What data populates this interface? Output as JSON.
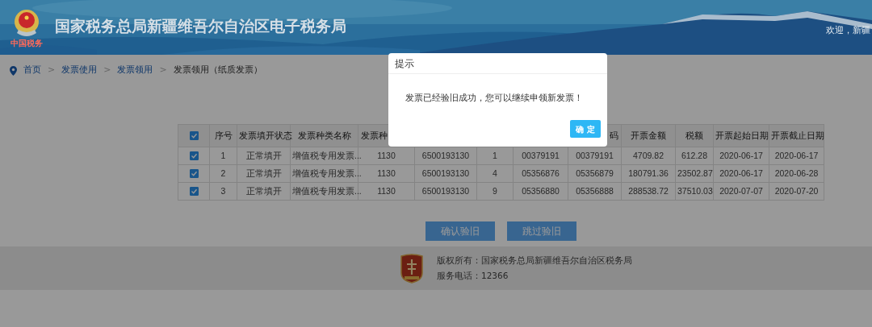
{
  "header": {
    "logo_caption": "中国税务",
    "title": "国家税务总局新疆维吾尔自治区电子税务局",
    "welcome": "欢迎，新疆"
  },
  "breadcrumb": {
    "items": [
      {
        "label": "首页",
        "kind": "link"
      },
      {
        "label": "发票使用",
        "kind": "link"
      },
      {
        "label": "发票领用",
        "kind": "link"
      },
      {
        "label": "发票领用（纸质发票）",
        "kind": "text"
      }
    ],
    "separators": [
      ">",
      ">",
      ">"
    ]
  },
  "table": {
    "select_all": {
      "checked": true
    },
    "columns": [
      "序号",
      "发票填开状态",
      "发票种类名称",
      "发票种",
      null,
      null,
      null,
      "码",
      "开票金额",
      "税额",
      "开票起始日期",
      "开票截止日期"
    ],
    "rows": [
      {
        "checked": true,
        "cells": [
          "1",
          "正常填开",
          "增值税专用发票...",
          "1130",
          "6500193130",
          "1",
          "00379191",
          "00379191",
          "4709.82",
          "612.28",
          "2020-06-17",
          "2020-06-17"
        ]
      },
      {
        "checked": true,
        "cells": [
          "2",
          "正常填开",
          "增值税专用发票...",
          "1130",
          "6500193130",
          "4",
          "05356876",
          "05356879",
          "180791.36",
          "23502.87",
          "2020-06-17",
          "2020-06-28"
        ]
      },
      {
        "checked": true,
        "cells": [
          "3",
          "正常填开",
          "增值税专用发票...",
          "1130",
          "6500193130",
          "9",
          "05356880",
          "05356888",
          "288538.72",
          "37510.03",
          "2020-07-07",
          "2020-07-20"
        ]
      }
    ]
  },
  "buttons": [
    "确认验旧",
    "跳过验旧"
  ],
  "footer": {
    "copyright": "版权所有：国家税务总局新疆维吾尔自治区税务局",
    "phone": "服务电话：12366"
  },
  "dialog": {
    "title": "提示",
    "message": "发票已经验旧成功，您可以继续申领新发票！",
    "button": "确 定"
  }
}
